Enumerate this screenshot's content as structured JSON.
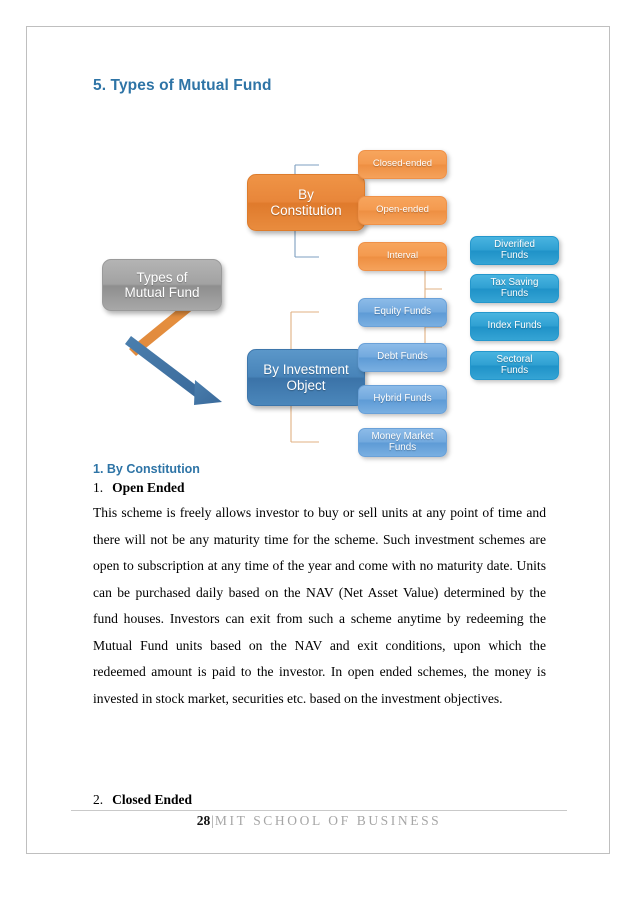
{
  "page": {
    "section_heading": "5. Types of Mutual Fund"
  },
  "diagram": {
    "title": "Types of Mutual Fund classification tree",
    "root": {
      "label": "Types of\nMutual Fund",
      "color": "#a2a2a2"
    },
    "branches": [
      {
        "label": "By\nConstitution",
        "color": "#e8863a",
        "children": [
          {
            "label": "Closed-ended",
            "color": "#f49a4f"
          },
          {
            "label": "Open-ended",
            "color": "#f49a4f"
          },
          {
            "label": "Interval",
            "color": "#f49a4f"
          }
        ]
      },
      {
        "label": "By Investment\nObject",
        "color": "#4884b9",
        "children": [
          {
            "label": "Equity Funds",
            "color": "#72a9de",
            "children": [
              {
                "label": "Diverified\nFunds",
                "color": "#2fa0d2"
              },
              {
                "label": "Tax Saving\nFunds",
                "color": "#2fa0d2"
              },
              {
                "label": "Index Funds",
                "color": "#2fa0d2"
              },
              {
                "label": "Sectoral\nFunds",
                "color": "#2fa0d2"
              }
            ]
          },
          {
            "label": "Debt Funds",
            "color": "#72a9de"
          },
          {
            "label": "Hybrid Funds",
            "color": "#72a9de"
          },
          {
            "label": "Money Market\nFunds",
            "color": "#72a9de"
          }
        ]
      }
    ],
    "nodes": {
      "root": "Types of\nMutual Fund",
      "by_constitution": "By\nConstitution",
      "closed_ended": "Closed-ended",
      "open_ended": "Open-ended",
      "interval": "Interval",
      "by_investment_object": "By Investment\nObject",
      "equity_funds": "Equity Funds",
      "debt_funds": "Debt Funds",
      "hybrid_funds": "Hybrid Funds",
      "money_market_funds": "Money Market\nFunds",
      "diverified_funds": "Diverified\nFunds",
      "tax_saving_funds": "Tax Saving\nFunds",
      "index_funds": "Index Funds",
      "sectoral_funds": "Sectoral\nFunds"
    }
  },
  "content": {
    "subsection_heading": "1.  By Constitution",
    "item1_number": "1.",
    "item1_title": "Open Ended",
    "item1_body": "This scheme is freely allows investor to buy or sell units at any point of time and there will not be any maturity time for the scheme. Such investment schemes are open to subscription at any time of the year and come with no maturity date. Units can be purchased daily based on the NAV (Net Asset Value) determined by the fund houses. Investors can exit from such a scheme anytime by redeeming the Mutual Fund units based on the NAV and exit conditions, upon which the redeemed amount is paid to the investor. In open ended schemes, the money is invested in stock market, securities etc. based on the investment objectives.",
    "item2_number": "2.",
    "item2_title": "Closed Ended"
  },
  "footer": {
    "page_number": "28",
    "separator": "|",
    "organization": "MIT SCHOOL OF BUSINESS"
  },
  "colors": {
    "heading_blue": "#2E74A6",
    "orange_main": "#e8863a",
    "orange_light": "#f49a4f",
    "blue_main": "#4884b9",
    "blue_light": "#72a9de",
    "cyan": "#2fa0d2",
    "gray_root": "#a2a2a2",
    "connector_blue": "#7d9fc0",
    "connector_orange": "#e0b183"
  }
}
